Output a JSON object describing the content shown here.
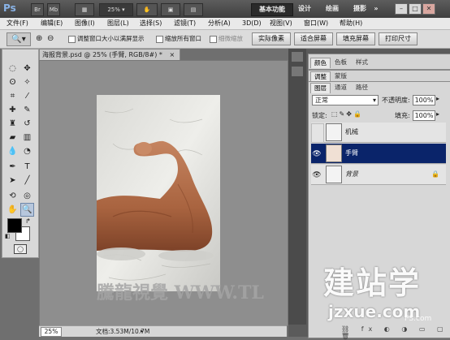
{
  "app": {
    "logo": "Ps",
    "br_label": "Br",
    "mb_label": "Mb",
    "zoom_display": "25%",
    "workspaces": [
      "基本功能",
      "设计",
      "绘画",
      "摄影"
    ],
    "workspace_more": "»",
    "window_buttons": [
      "–",
      "□",
      "✕"
    ]
  },
  "menubar": {
    "items": [
      "文件(F)",
      "编辑(E)",
      "图像(I)",
      "图层(L)",
      "选择(S)",
      "滤镜(T)",
      "分析(A)",
      "3D(D)",
      "视图(V)",
      "窗口(W)",
      "帮助(H)"
    ]
  },
  "options": {
    "check1": "调整窗口大小以满屏显示",
    "check2": "缩放所有窗口",
    "check3": "细微缩放",
    "btn_actual": "实际像素",
    "btn_fit": "适合屏幕",
    "btn_fill": "填充屏幕",
    "btn_print": "打印尺寸"
  },
  "document": {
    "tab_title": "海报背景.psd @ 25% (手臂, RGB/8#) *",
    "tab_close": "×",
    "zoom": "25%",
    "doc_info": "文档:3.53M/10.7M",
    "watermark": "騰龍視覺 WWW.TL"
  },
  "panels": {
    "group1_tabs": [
      "颜色",
      "色板",
      "样式"
    ],
    "group2_tabs": [
      "调整",
      "蒙版"
    ],
    "layers_tabs": [
      "图层",
      "通道",
      "路径"
    ],
    "blend_mode": "正常",
    "opacity_label": "不透明度:",
    "opacity_value": "100%",
    "lock_label": "锁定:",
    "fill_label": "填充:",
    "fill_value": "100%",
    "layers": [
      {
        "name": "机械",
        "visible": false,
        "selected": false
      },
      {
        "name": "手臂",
        "visible": true,
        "selected": true
      },
      {
        "name": "背景",
        "visible": true,
        "selected": false,
        "locked": true
      }
    ]
  },
  "corner_watermark": {
    "big": "建站学",
    "url": "jzxue.com",
    "sub": "PS.com"
  },
  "colors": {
    "accent_selected": "#0a246a",
    "skin": "#b5714f"
  }
}
